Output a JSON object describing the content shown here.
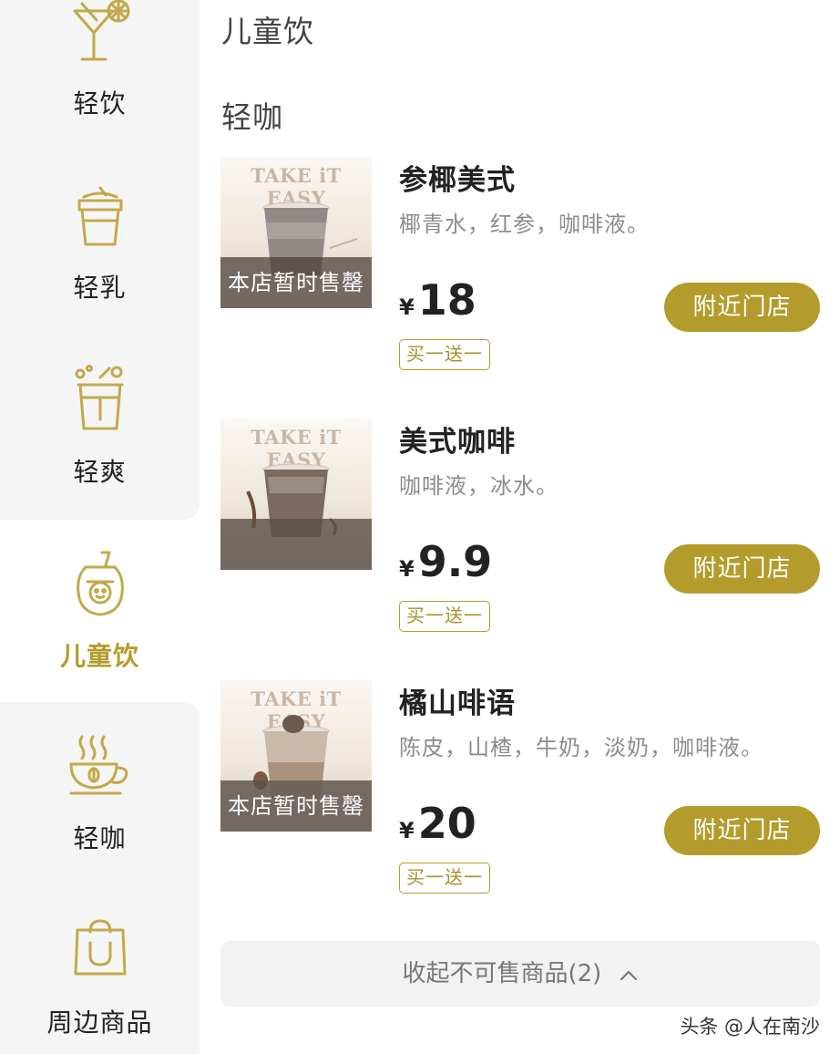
{
  "sidebar": {
    "items": [
      {
        "label": "轻饮",
        "icon": "cocktail-icon"
      },
      {
        "label": "轻乳",
        "icon": "milk-cup-icon"
      },
      {
        "label": "轻爽",
        "icon": "fizzy-drink-icon"
      },
      {
        "label": "儿童饮",
        "icon": "kids-drink-icon",
        "active": true
      },
      {
        "label": "轻咖",
        "icon": "coffee-cup-icon"
      },
      {
        "label": "周边商品",
        "icon": "shopping-bag-icon"
      }
    ]
  },
  "sections": {
    "kids_title": "儿童饮",
    "coffee_title": "轻咖"
  },
  "products": [
    {
      "name": "参椰美式",
      "desc": "椰青水，红参，咖啡液。",
      "currency": "¥",
      "price": "18",
      "promo": "买一送一",
      "button": "附近门店",
      "brand": "TAKE iT EASY",
      "status": "本店暂时售罄"
    },
    {
      "name": "美式咖啡",
      "desc": "咖啡液，冰水。",
      "currency": "¥",
      "price": "9.9",
      "promo": "买一送一",
      "button": "附近门店",
      "brand": "TAKE iT EASY",
      "status": ""
    },
    {
      "name": "橘山啡语",
      "desc": "陈皮，山楂，牛奶，淡奶，咖啡液。",
      "currency": "¥",
      "price": "20",
      "promo": "买一送一",
      "button": "附近门店",
      "brand": "TAKE iT EASY",
      "status": "本店暂时售罄"
    }
  ],
  "collapse": {
    "label": "收起不可售商品(2)"
  },
  "watermark": "头条 @人在南沙",
  "colors": {
    "accent": "#b39c2c",
    "sidebar_bg": "#f5f5f5",
    "sold_out_overlay": "#5a524b"
  }
}
